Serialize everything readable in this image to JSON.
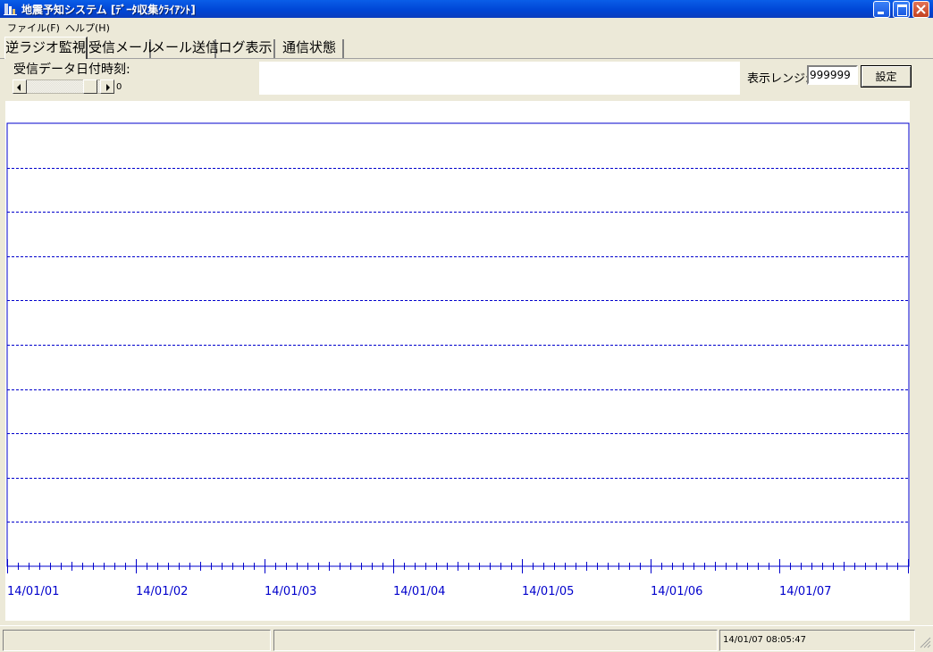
{
  "window": {
    "title": "地震予知システム [ﾃﾞｰﾀ収集ｸﾗｲｱﾝﾄ]",
    "icon": "app-icon"
  },
  "menu": {
    "items": [
      {
        "label": "ファイル(F)"
      },
      {
        "label": "ヘルプ(H)"
      }
    ]
  },
  "tabs": [
    {
      "label": "逆ラジオ監視",
      "active": true
    },
    {
      "label": "受信メール"
    },
    {
      "label": "メール送信"
    },
    {
      "label": "ログ表示"
    },
    {
      "label": "通信状態"
    }
  ],
  "controls": {
    "date_label": "受信データ日付時刻:",
    "scroll_value": "0",
    "range_label": "表示レンジ:",
    "range_value": "999999",
    "set_button": "設定"
  },
  "chart_data": {
    "type": "line",
    "title": "",
    "xlabel": "",
    "ylabel": "",
    "categories": [
      "14/01/01",
      "14/01/02",
      "14/01/03",
      "14/01/04",
      "14/01/05",
      "14/01/06",
      "14/01/07"
    ],
    "series": [],
    "horizontal_gridlines": 9,
    "minor_ticks_per_day": 12,
    "grid": true,
    "grid_style": "dashed",
    "colors": {
      "axis": "#0000cc",
      "grid": "#0000cc",
      "tick_label": "#0000cc"
    }
  },
  "statusbar": {
    "panels": [
      "",
      "",
      "14/01/07 08:05:47"
    ]
  }
}
